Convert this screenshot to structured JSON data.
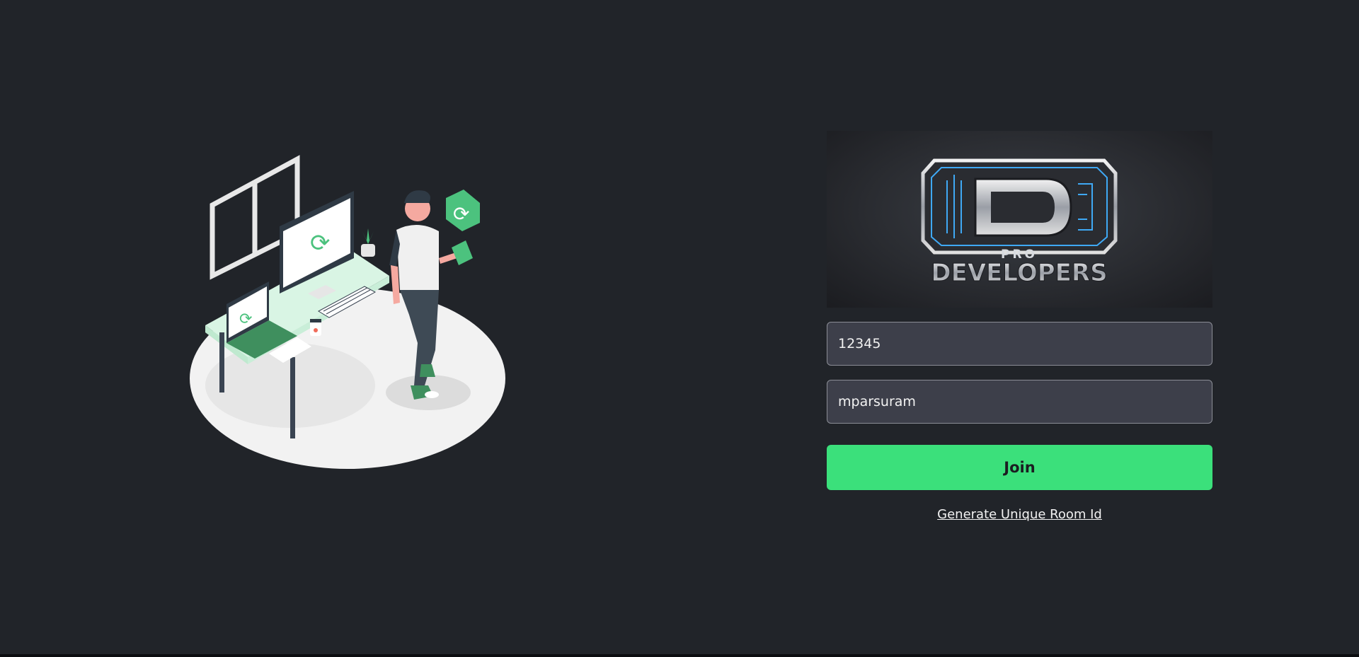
{
  "illustration": {
    "icon": "person-at-desk-sync-illustration",
    "accent": "#4cc27e"
  },
  "logo": {
    "icon": "pro-developers-logo",
    "line1": "PRO",
    "line2": "DEVELOPERS",
    "glow": "#3fa9f5"
  },
  "form": {
    "room_id_value": "12345",
    "username_value": "mparsuram",
    "join_label": "Join",
    "generate_link_label": "Generate Unique Room Id"
  },
  "colors": {
    "background": "#212429",
    "button": "#3be07b",
    "input_bg": "#3d3f4a"
  }
}
